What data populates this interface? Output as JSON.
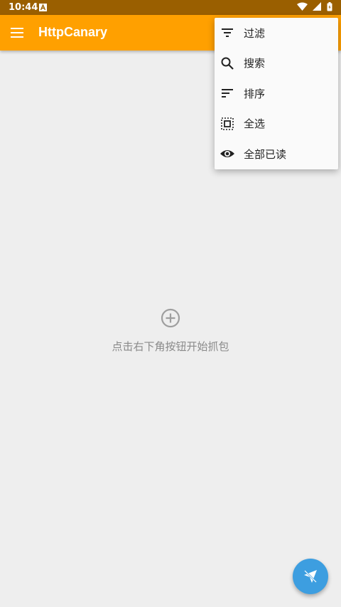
{
  "status_bar": {
    "time": "10:44"
  },
  "app_bar": {
    "title": "HttpCanary",
    "background": "#ffa000"
  },
  "popup_menu": {
    "items": [
      {
        "label": "过滤",
        "icon": "filter-icon"
      },
      {
        "label": "搜索",
        "icon": "search-icon"
      },
      {
        "label": "排序",
        "icon": "sort-icon"
      },
      {
        "label": "全选",
        "icon": "select-all-icon"
      },
      {
        "label": "全部已读",
        "icon": "eye-icon"
      }
    ]
  },
  "empty_state": {
    "icon": "add-circle-icon",
    "text": "点击右下角按钮开始抓包"
  },
  "fab": {
    "icon": "capture-plane-icon",
    "color": "#3d9ee0"
  }
}
